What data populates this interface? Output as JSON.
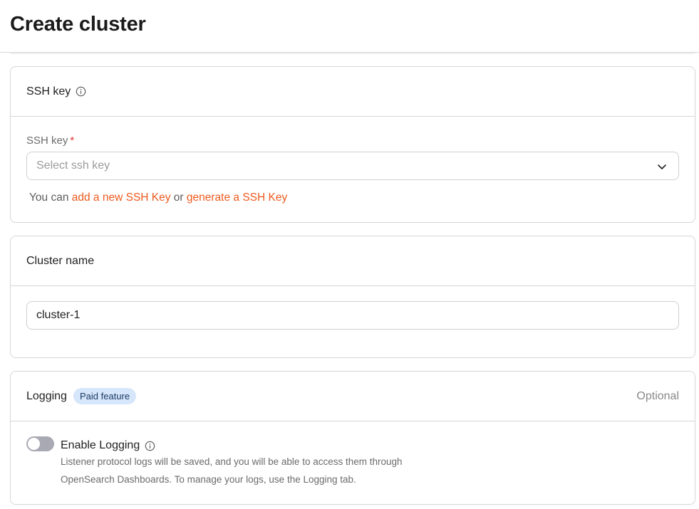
{
  "page": {
    "title": "Create cluster"
  },
  "ssh_section": {
    "title": "SSH key",
    "field_label": "SSH key",
    "required_mark": "*",
    "select_placeholder": "Select ssh key",
    "hint_prefix": "You can ",
    "link_add": "add a new SSH Key",
    "hint_or": " or ",
    "link_generate": "generate a SSH Key"
  },
  "cluster_section": {
    "title": "Cluster name",
    "input_value": "cluster-1"
  },
  "logging_section": {
    "title": "Logging",
    "badge": "Paid feature",
    "optional": "Optional",
    "toggle_label": "Enable Logging",
    "toggle_on": false,
    "description_line1": "Listener protocol logs will be saved, and you will be able to access them through",
    "description_line2": "OpenSearch Dashboards. To manage your logs, use the Logging tab."
  },
  "colors": {
    "accent_link": "#ee5a1e",
    "required": "#e5322d",
    "badge_bg": "#d6e6fb"
  },
  "icons": [
    "info-icon",
    "chevron-down-icon"
  ]
}
